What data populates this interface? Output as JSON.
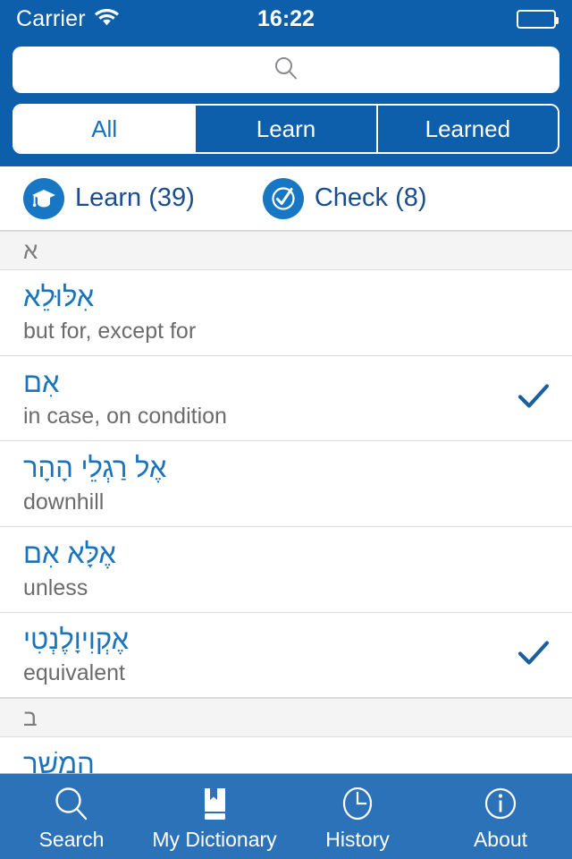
{
  "statusbar": {
    "carrier": "Carrier",
    "time": "16:22",
    "wifi_icon": "wifi-icon",
    "battery_icon": "battery-full-icon"
  },
  "search": {
    "value": "",
    "placeholder": "",
    "icon": "search-icon"
  },
  "segmented": {
    "selected": "All",
    "options": [
      {
        "label": "All",
        "active": true
      },
      {
        "label": "Learn",
        "active": false
      },
      {
        "label": "Learned",
        "active": false
      }
    ]
  },
  "actions": [
    {
      "label": "Learn (39)",
      "icon": "graduation-cap-icon",
      "count": 39
    },
    {
      "label": "Check (8)",
      "icon": "check-circle-icon",
      "count": 8
    }
  ],
  "list": [
    {
      "type": "section",
      "letter": "א"
    },
    {
      "type": "entry",
      "hebrew": "אִלּוּלֵא",
      "english": "but for, except for",
      "learned": false
    },
    {
      "type": "entry",
      "hebrew": "אִם",
      "english": "in case, on condition",
      "learned": true
    },
    {
      "type": "entry",
      "hebrew": "אֶל רַגְלֵי הָהָר",
      "english": "downhill",
      "learned": false
    },
    {
      "type": "entry",
      "hebrew": "אֶלָּא אִם",
      "english": "unless",
      "learned": false
    },
    {
      "type": "entry",
      "hebrew": "אֶקְוִיוָלֶנְטִי",
      "english": "equivalent",
      "learned": true
    },
    {
      "type": "section",
      "letter": "ב"
    },
    {
      "type": "entry",
      "hebrew": "הֶמשֵׁך",
      "english": "",
      "learned": false,
      "clipped": true
    }
  ],
  "tabs": [
    {
      "label": "Search",
      "icon": "search-icon"
    },
    {
      "label": "My Dictionary",
      "icon": "book-bookmark-icon"
    },
    {
      "label": "History",
      "icon": "clock-icon"
    },
    {
      "label": "About",
      "icon": "info-circle-icon"
    }
  ],
  "colors": {
    "header_blue": "#0e5fab",
    "tabbar_blue": "#2b72b8",
    "accent_blue": "#1a74bd",
    "check_blue": "#1a5fa0",
    "section_bg": "#f4f4f4",
    "secondary_text": "#6b6b6b"
  }
}
